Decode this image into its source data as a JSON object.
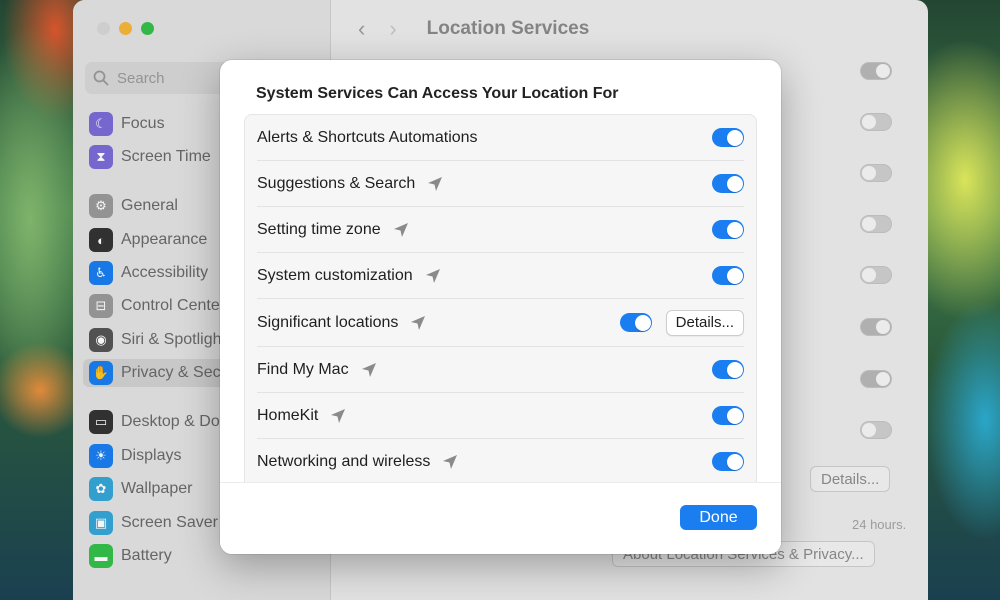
{
  "window": {
    "title": "Location Services",
    "search_placeholder": "Search"
  },
  "sidebar": {
    "items": [
      {
        "label": "Focus",
        "icon": "moon-icon",
        "color": "#7a6cd6"
      },
      {
        "label": "Screen Time",
        "icon": "hourglass-icon",
        "color": "#7a6cd6"
      },
      {
        "label": "General",
        "icon": "gear-icon",
        "color": "#9a9a9a"
      },
      {
        "label": "Appearance",
        "icon": "appearance-icon",
        "color": "#333333"
      },
      {
        "label": "Accessibility",
        "icon": "accessibility-icon",
        "color": "#1a7ef0"
      },
      {
        "label": "Control Cente",
        "icon": "control-center-icon",
        "color": "#9a9a9a"
      },
      {
        "label": "Siri & Spotligh",
        "icon": "siri-icon",
        "color": "#555555"
      },
      {
        "label": "Privacy & Sec",
        "icon": "hand-icon",
        "color": "#1a7ef0"
      },
      {
        "label": "Desktop & Do",
        "icon": "desktop-icon",
        "color": "#333333"
      },
      {
        "label": "Displays",
        "icon": "sun-icon",
        "color": "#1a7ef0"
      },
      {
        "label": "Wallpaper",
        "icon": "flower-icon",
        "color": "#35a6d8"
      },
      {
        "label": "Screen Saver",
        "icon": "screensaver-icon",
        "color": "#35a6d8"
      },
      {
        "label": "Battery",
        "icon": "battery-icon",
        "color": "#34c04a"
      }
    ]
  },
  "background": {
    "details_label": "Details...",
    "note_text": "24 hours.",
    "about_label": "About Location Services & Privacy..."
  },
  "sheet": {
    "title": "System Services Can Access Your Location For",
    "rows": [
      {
        "label": "Alerts & Shortcuts Automations",
        "enabled": true,
        "arrow": false
      },
      {
        "label": "Suggestions & Search",
        "enabled": true,
        "arrow": true
      },
      {
        "label": "Setting time zone",
        "enabled": true,
        "arrow": true
      },
      {
        "label": "System customization",
        "enabled": true,
        "arrow": true
      },
      {
        "label": "Significant locations",
        "enabled": true,
        "arrow": true,
        "details_label": "Details..."
      },
      {
        "label": "Find My Mac",
        "enabled": true,
        "arrow": true
      },
      {
        "label": "HomeKit",
        "enabled": true,
        "arrow": true
      },
      {
        "label": "Networking and wireless",
        "enabled": true,
        "arrow": true
      }
    ],
    "done_label": "Done"
  },
  "colors": {
    "accent": "#1a7ef0"
  }
}
